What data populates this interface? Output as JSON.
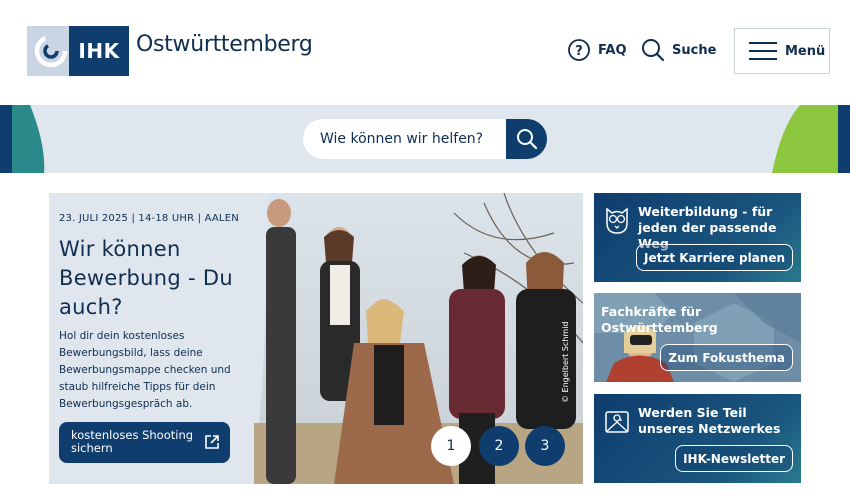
{
  "header": {
    "logo_ihk": "IHK",
    "logo_name": "Ostwürttemberg",
    "faq_label": "FAQ",
    "search_label": "Suche",
    "menu_label": "Menü"
  },
  "search": {
    "placeholder": "Wie können wir helfen?"
  },
  "hero": {
    "date": "23. JULI 2025 | 14-18 UHR | AALEN",
    "title": "Wir können Bewerbung - Du auch?",
    "description": "Hol dir dein kostenloses Bewerbungsbild, lass deine Bewerbungsmappe checken und staub hilfreiche Tipps für dein Bewerbungsgespräch ab.",
    "cta_line1": "kostenloses Shooting",
    "cta_line2": "sichern",
    "pages": [
      "1",
      "2",
      "3"
    ],
    "credit": "© Engelbert Schmid"
  },
  "cards": [
    {
      "title": "Weiterbildung - für jeden der passende Weg",
      "button": "Jetzt Karriere planen",
      "icon": "owl-icon"
    },
    {
      "title": "Fachkräfte für Ostwürttemberg",
      "button": "Zum Fokusthema",
      "icon": "binoculars-photo"
    },
    {
      "title": "Werden Sie Teil unseres Netzwerkes",
      "button": "IHK-Newsletter",
      "icon": "mail-icon"
    }
  ],
  "colors": {
    "brand_dark": "#0f3d6e",
    "band_bg": "#dfe6ee",
    "accent_green": "#8cc63f",
    "accent_teal": "#2a8a8a"
  }
}
